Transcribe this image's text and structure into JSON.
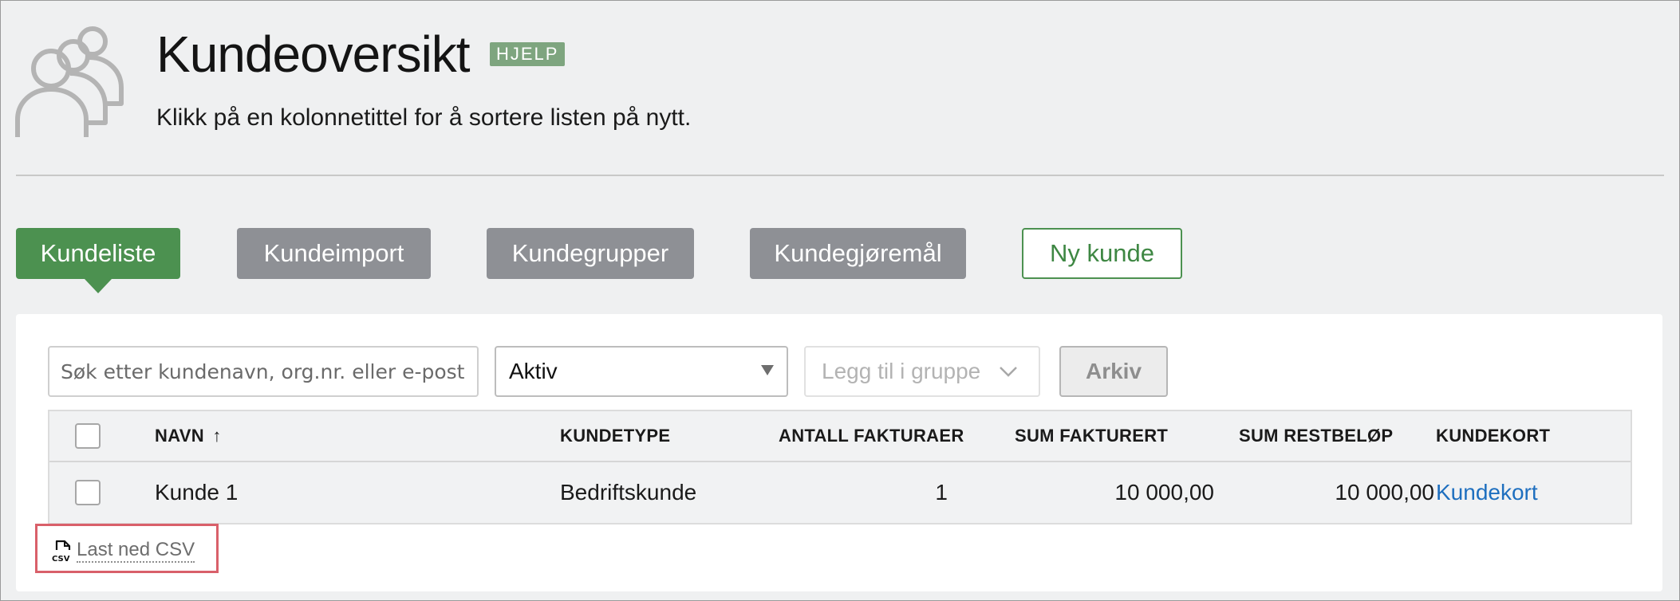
{
  "header": {
    "title": "Kundeoversikt",
    "help_badge": "HJELP",
    "subtitle": "Klikk på en kolonnetittel for å sortere listen på nytt.",
    "icon": "customers-group-icon"
  },
  "tabs": [
    {
      "label": "Kundeliste",
      "state": "active"
    },
    {
      "label": "Kundeimport",
      "state": "inactive"
    },
    {
      "label": "Kundegrupper",
      "state": "inactive"
    },
    {
      "label": "Kundegjøremål",
      "state": "inactive"
    },
    {
      "label": "Ny kunde",
      "state": "outline"
    }
  ],
  "filters": {
    "search_placeholder": "Søk etter kundenavn, org.nr. eller e-post",
    "search_value": "",
    "status_selected": "Aktiv",
    "group_placeholder": "Legg til i gruppe",
    "archive_label": "Arkiv"
  },
  "table": {
    "columns": [
      "NAVN",
      "KUNDETYPE",
      "ANTALL FAKTURAER",
      "SUM FAKTURERT",
      "SUM RESTBELØP",
      "KUNDEKORT"
    ],
    "sort_indicator": "↑",
    "rows": [
      {
        "name": "Kunde 1",
        "type": "Bedriftskunde",
        "invoice_count": "1",
        "sum_invoiced": "10 000,00",
        "sum_remaining": "10 000,00",
        "card_link": "Kundekort"
      }
    ]
  },
  "csv": {
    "label": "Last ned CSV",
    "icon": "csv-file-icon"
  },
  "colors": {
    "accent": "#4c9150",
    "inactive_tab": "#8e9095",
    "help_badge": "#7ea57f",
    "link": "#1e6fbf",
    "highlight": "#d9606a"
  }
}
